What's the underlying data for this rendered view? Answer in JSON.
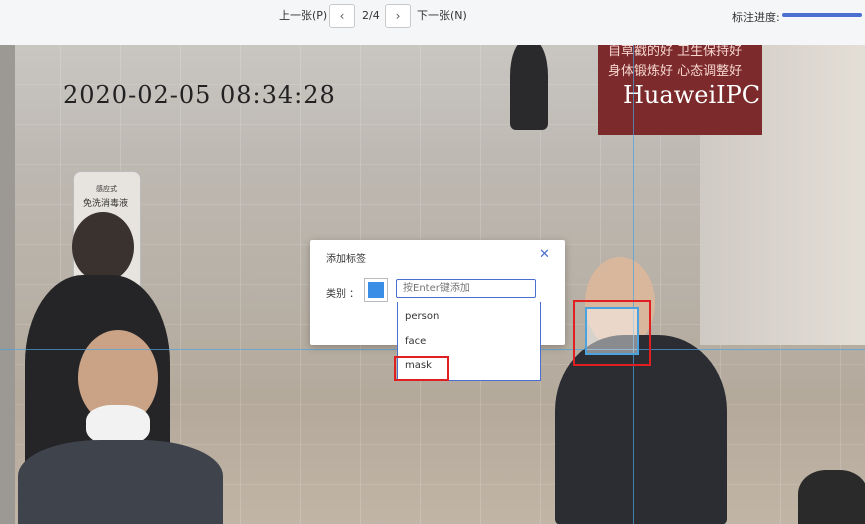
{
  "toolbar": {
    "prev_label": "上一张(P)",
    "page_indicator": "2/4",
    "next_label": "下一张(N)",
    "progress_label": "标注进度:",
    "progress_fraction": 1.0,
    "prev_icon": "chevron-left-icon",
    "next_icon": "chevron-right-icon"
  },
  "image": {
    "timestamp": "2020-02-05  08:34:28",
    "camera_watermark": "HuaweiIPC",
    "banner_lines": [
      "自草戳的好  卫生保持好",
      "身体锻炼好  心态调整好"
    ],
    "sign_lines": [
      "感应式",
      "免洗消毒液"
    ]
  },
  "dialog": {
    "title": "添加标签",
    "close_icon": "close-icon",
    "category_label": "类别 ：",
    "swatch_color": "#3a8ee6",
    "input_placeholder": "按Enter键添加",
    "options": [
      "person",
      "face",
      "mask"
    ]
  },
  "colors": {
    "accent": "#4b6fd1",
    "guide": "#4aa3df",
    "highlight": "#e02020"
  }
}
